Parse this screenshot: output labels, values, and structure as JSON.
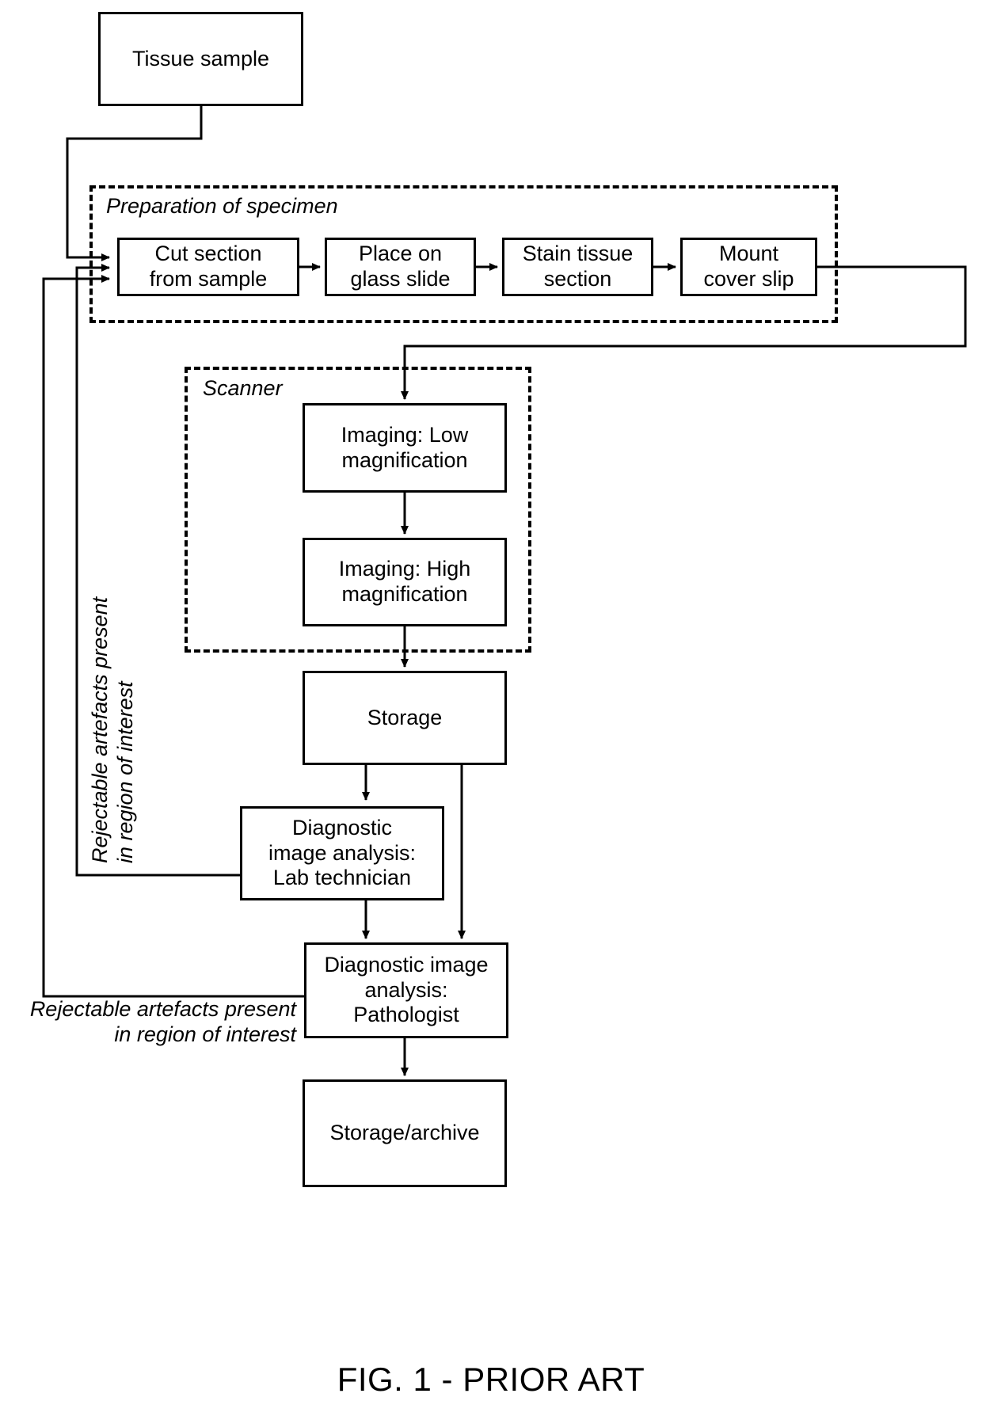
{
  "figure": {
    "caption": "FIG. 1 - PRIOR ART",
    "groups": [
      {
        "id": "preparation",
        "label": "Preparation of specimen"
      },
      {
        "id": "scanner",
        "label": "Scanner"
      }
    ],
    "nodes": [
      {
        "id": "tissue-sample",
        "label": "Tissue sample"
      },
      {
        "id": "cut-section",
        "label": "Cut section\nfrom sample"
      },
      {
        "id": "place-slide",
        "label": "Place on\nglass slide"
      },
      {
        "id": "stain-tissue",
        "label": "Stain tissue\nsection"
      },
      {
        "id": "mount-cover-slip",
        "label": "Mount\ncover slip"
      },
      {
        "id": "imaging-low",
        "label": "Imaging: Low\nmagnification"
      },
      {
        "id": "imaging-high",
        "label": "Imaging: High\nmagnification"
      },
      {
        "id": "storage",
        "label": "Storage"
      },
      {
        "id": "lab-technician",
        "label": "Diagnostic\nimage analysis:\nLab technician"
      },
      {
        "id": "pathologist",
        "label": "Diagnostic image\nanalysis:\nPathologist"
      },
      {
        "id": "storage-archive",
        "label": "Storage/archive"
      }
    ],
    "edge_labels": [
      {
        "id": "feedback-technician",
        "text": "Rejectable artefacts present\nin region of interest"
      },
      {
        "id": "feedback-pathologist",
        "text": "Rejectable artefacts present\nin region of interest"
      }
    ],
    "colors": {
      "stroke": "#000000",
      "background": "#ffffff"
    }
  },
  "chart_data": {
    "type": "diagram",
    "title": "FIG. 1 - PRIOR ART",
    "diagram_kind": "flowchart",
    "nodes": [
      "Tissue sample",
      "Cut section from sample",
      "Place on glass slide",
      "Stain tissue section",
      "Mount cover slip",
      "Imaging: Low magnification",
      "Imaging: High magnification",
      "Storage",
      "Diagnostic image analysis: Lab technician",
      "Diagnostic image analysis: Pathologist",
      "Storage/archive"
    ],
    "containers": [
      {
        "name": "Preparation of specimen",
        "contains": [
          "Cut section from sample",
          "Place on glass slide",
          "Stain tissue section",
          "Mount cover slip"
        ]
      },
      {
        "name": "Scanner",
        "contains": [
          "Imaging: Low magnification",
          "Imaging: High magnification"
        ]
      }
    ],
    "edges": [
      {
        "from": "Tissue sample",
        "to": "Cut section from sample",
        "label": ""
      },
      {
        "from": "Cut section from sample",
        "to": "Place on glass slide",
        "label": ""
      },
      {
        "from": "Place on glass slide",
        "to": "Stain tissue section",
        "label": ""
      },
      {
        "from": "Stain tissue section",
        "to": "Mount cover slip",
        "label": ""
      },
      {
        "from": "Mount cover slip",
        "to": "Imaging: Low magnification",
        "label": ""
      },
      {
        "from": "Imaging: Low magnification",
        "to": "Imaging: High magnification",
        "label": ""
      },
      {
        "from": "Imaging: High magnification",
        "to": "Storage",
        "label": ""
      },
      {
        "from": "Storage",
        "to": "Diagnostic image analysis: Lab technician",
        "label": ""
      },
      {
        "from": "Storage",
        "to": "Diagnostic image analysis: Pathologist",
        "label": ""
      },
      {
        "from": "Diagnostic image analysis: Lab technician",
        "to": "Diagnostic image analysis: Pathologist",
        "label": ""
      },
      {
        "from": "Diagnostic image analysis: Lab technician",
        "to": "Cut section from sample",
        "label": "Rejectable artefacts present in region of interest"
      },
      {
        "from": "Diagnostic image analysis: Pathologist",
        "to": "Cut section from sample",
        "label": "Rejectable artefacts present in region of interest"
      },
      {
        "from": "Diagnostic image analysis: Pathologist",
        "to": "Storage/archive",
        "label": ""
      }
    ]
  }
}
